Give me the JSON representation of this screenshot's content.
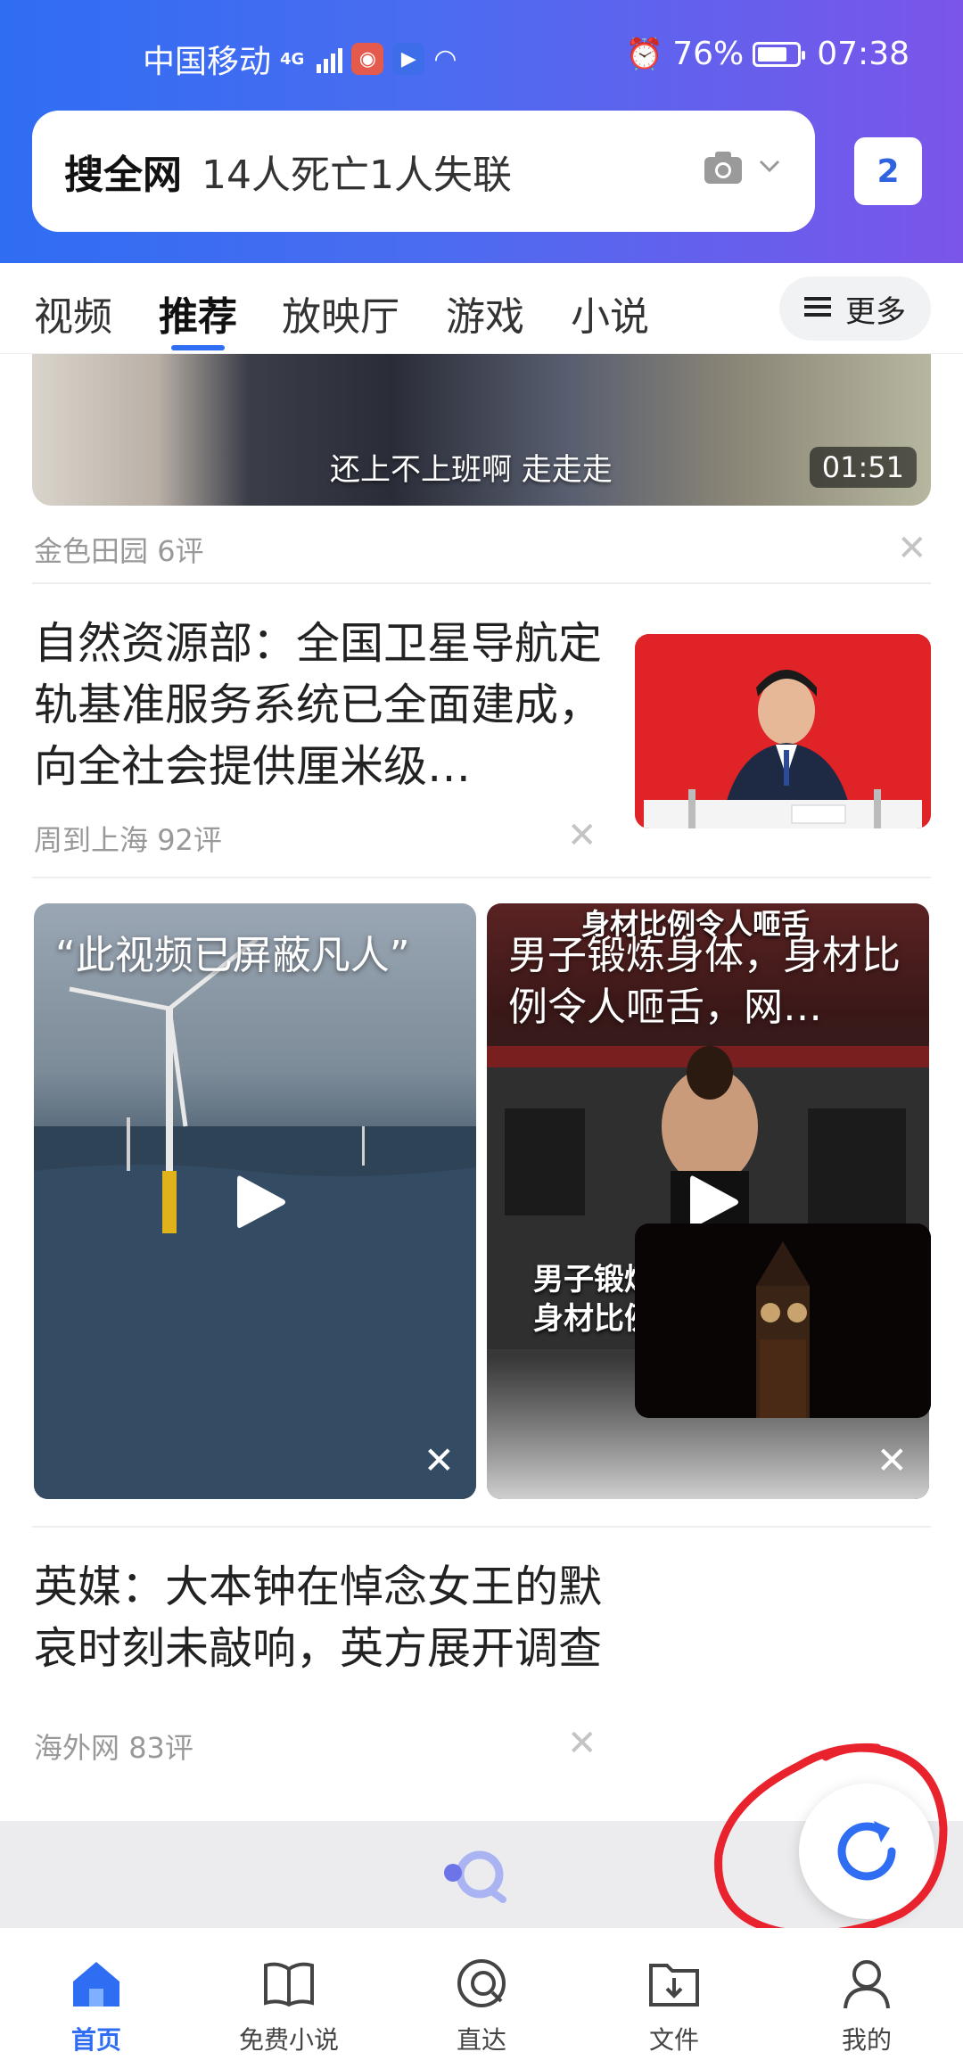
{
  "status_bar": {
    "carrier": "中国移动",
    "network": "4G",
    "battery": "76%",
    "battery_level": 0.76,
    "time": "07:38"
  },
  "search": {
    "brand": "搜全网",
    "query": "14人死亡1人失联",
    "tab_count": "2"
  },
  "channels": {
    "items": [
      "视频",
      "推荐",
      "放映厅",
      "游戏",
      "小说"
    ],
    "active": "推荐",
    "more_label": "更多"
  },
  "feed": {
    "video_top": {
      "subtitle": "还上不上班啊 走走走",
      "duration": "01:51",
      "source": "金色田园",
      "comments": "6评"
    },
    "news1": {
      "title": "自然资源部：全国卫星导航定轨基准服务系统已全面建成，向全社会提供厘米级…",
      "source": "周到上海",
      "comments": "92评"
    },
    "card_left": {
      "title": "“此视频已屏蔽凡人”"
    },
    "card_right": {
      "title": "男子锻炼身体，身材比例令人咂舌，网…",
      "overlay_top": "身材比例令人咂舌",
      "overlay_caption_line1": "男子锻炼身体",
      "overlay_caption_line2": "身材比例令人咂舌"
    },
    "news2": {
      "title": "英媒：大本钟在悼念女王的默哀时刻未敲响，英方展开调查",
      "source": "海外网",
      "comments": "83评"
    }
  },
  "bottom_nav": {
    "items": [
      {
        "label": "首页",
        "icon": "home-icon"
      },
      {
        "label": "免费小说",
        "icon": "book-icon"
      },
      {
        "label": "直达",
        "icon": "direct-icon"
      },
      {
        "label": "文件",
        "icon": "file-download-icon"
      },
      {
        "label": "我的",
        "icon": "user-icon"
      }
    ],
    "active": "首页"
  },
  "colors": {
    "accent": "#2f6df3",
    "header_gradient_start": "#2f6df3",
    "header_gradient_end": "#7b55ea",
    "annotation_red": "#e8232e"
  }
}
